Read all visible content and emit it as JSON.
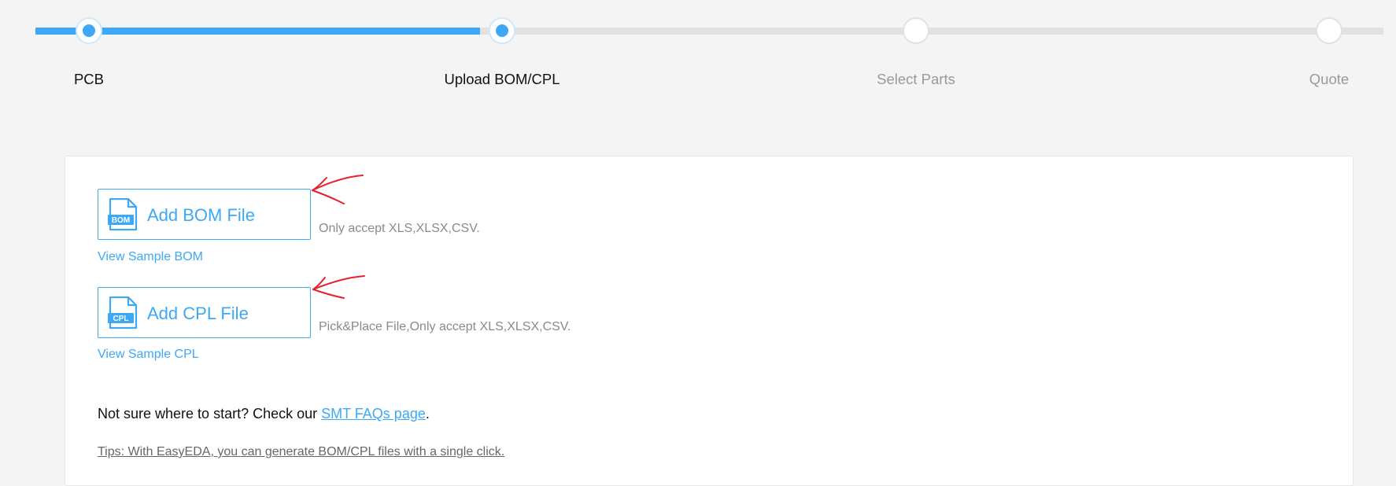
{
  "stepper": {
    "progress_fraction": 0.33,
    "steps": [
      {
        "label": "PCB",
        "state": "done"
      },
      {
        "label": "Upload BOM/CPL",
        "state": "current"
      },
      {
        "label": "Select Parts",
        "state": "pending"
      },
      {
        "label": "Quote",
        "state": "pending"
      }
    ]
  },
  "upload": {
    "bom": {
      "button_label": "Add BOM File",
      "icon": "bom-file-icon",
      "icon_text": "BOM",
      "hint": "Only accept XLS,XLSX,CSV.",
      "sample_link": "View Sample BOM"
    },
    "cpl": {
      "button_label": "Add CPL File",
      "icon": "cpl-file-icon",
      "icon_text": "CPL",
      "hint": "Pick&Place File,Only accept XLS,XLSX,CSV.",
      "sample_link": "View Sample CPL"
    }
  },
  "help": {
    "prefix": "Not sure where to start? Check our ",
    "link": "SMT FAQs page",
    "suffix": "."
  },
  "tips": "Tips: With EasyEDA, you can generate BOM/CPL files with a single click.",
  "annotations": {
    "arrow_color": "#e8202a"
  },
  "colors": {
    "accent": "#3da8f5",
    "track_inactive": "#e1e1e1",
    "background": "#f4f4f4"
  }
}
